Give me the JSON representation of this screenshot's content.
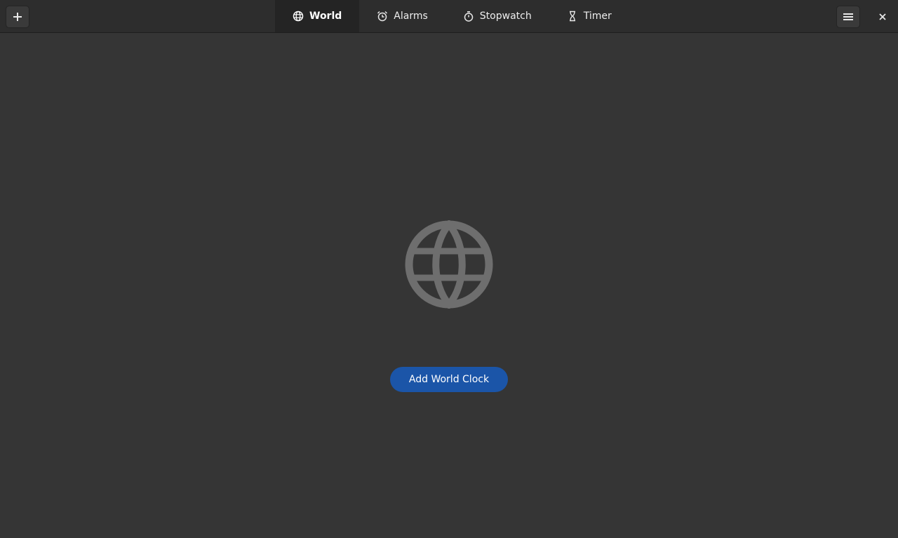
{
  "header": {
    "add_icon": "plus-icon",
    "menu_icon": "hamburger-menu-icon",
    "close_icon": "close-icon",
    "tabs": [
      {
        "label": "World",
        "icon": "globe-icon",
        "active": true
      },
      {
        "label": "Alarms",
        "icon": "alarm-clock-icon",
        "active": false
      },
      {
        "label": "Stopwatch",
        "icon": "stopwatch-icon",
        "active": false
      },
      {
        "label": "Timer",
        "icon": "hourglass-icon",
        "active": false
      }
    ]
  },
  "main": {
    "empty_icon": "globe-icon",
    "add_button_label": "Add World Clock"
  },
  "colors": {
    "background": "#353535",
    "headerbar": "#2d2d2d",
    "active_tab": "#242424",
    "accent_button": "#1b55a8",
    "empty_icon": "#6e6e6e"
  }
}
